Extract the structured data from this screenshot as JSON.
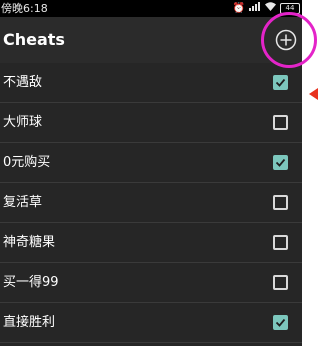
{
  "status_bar": {
    "time": "傍晚6:18",
    "icons": [
      "alarm-icon",
      "signal-icon",
      "wifi-icon"
    ],
    "battery": "44"
  },
  "app_bar": {
    "title": "Cheats",
    "add_icon": "plus-circle-icon"
  },
  "cheats": [
    {
      "label": "不遇敌",
      "checked": true
    },
    {
      "label": "大师球",
      "checked": false
    },
    {
      "label": "0元购买",
      "checked": true
    },
    {
      "label": "复活草",
      "checked": false
    },
    {
      "label": "神奇糖果",
      "checked": false
    },
    {
      "label": "买一得99",
      "checked": false
    },
    {
      "label": "直接胜利",
      "checked": true
    }
  ],
  "colors": {
    "background": "#262626",
    "app_bar": "#2b2b2b",
    "check_accent": "#7cc7bd",
    "annotation_ring": "#e424c9",
    "annotation_arrow": "#e8321e"
  }
}
